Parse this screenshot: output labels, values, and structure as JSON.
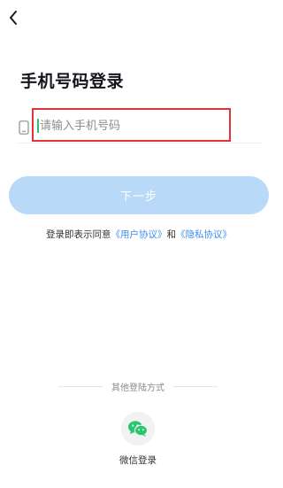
{
  "header": {
    "back_icon": "chevron-left-icon"
  },
  "page": {
    "title": "手机号码登录"
  },
  "phone": {
    "icon": "mobile-phone-icon",
    "placeholder": "请输入手机号码",
    "value": ""
  },
  "next_button": {
    "label": "下一步"
  },
  "agreement": {
    "prefix": "登录即表示同意",
    "user_agreement": "《用户协议》",
    "and": "和",
    "privacy_agreement": "《隐私协议》"
  },
  "other_login": {
    "label": "其他登陆方式",
    "wechat_icon": "wechat-icon",
    "wechat_label": "微信登录"
  },
  "colors": {
    "accent": "#3b8ff0",
    "button_disabled": "#b9d9f9",
    "highlight_border": "#e0333a",
    "wechat_green": "#2ac66e"
  }
}
